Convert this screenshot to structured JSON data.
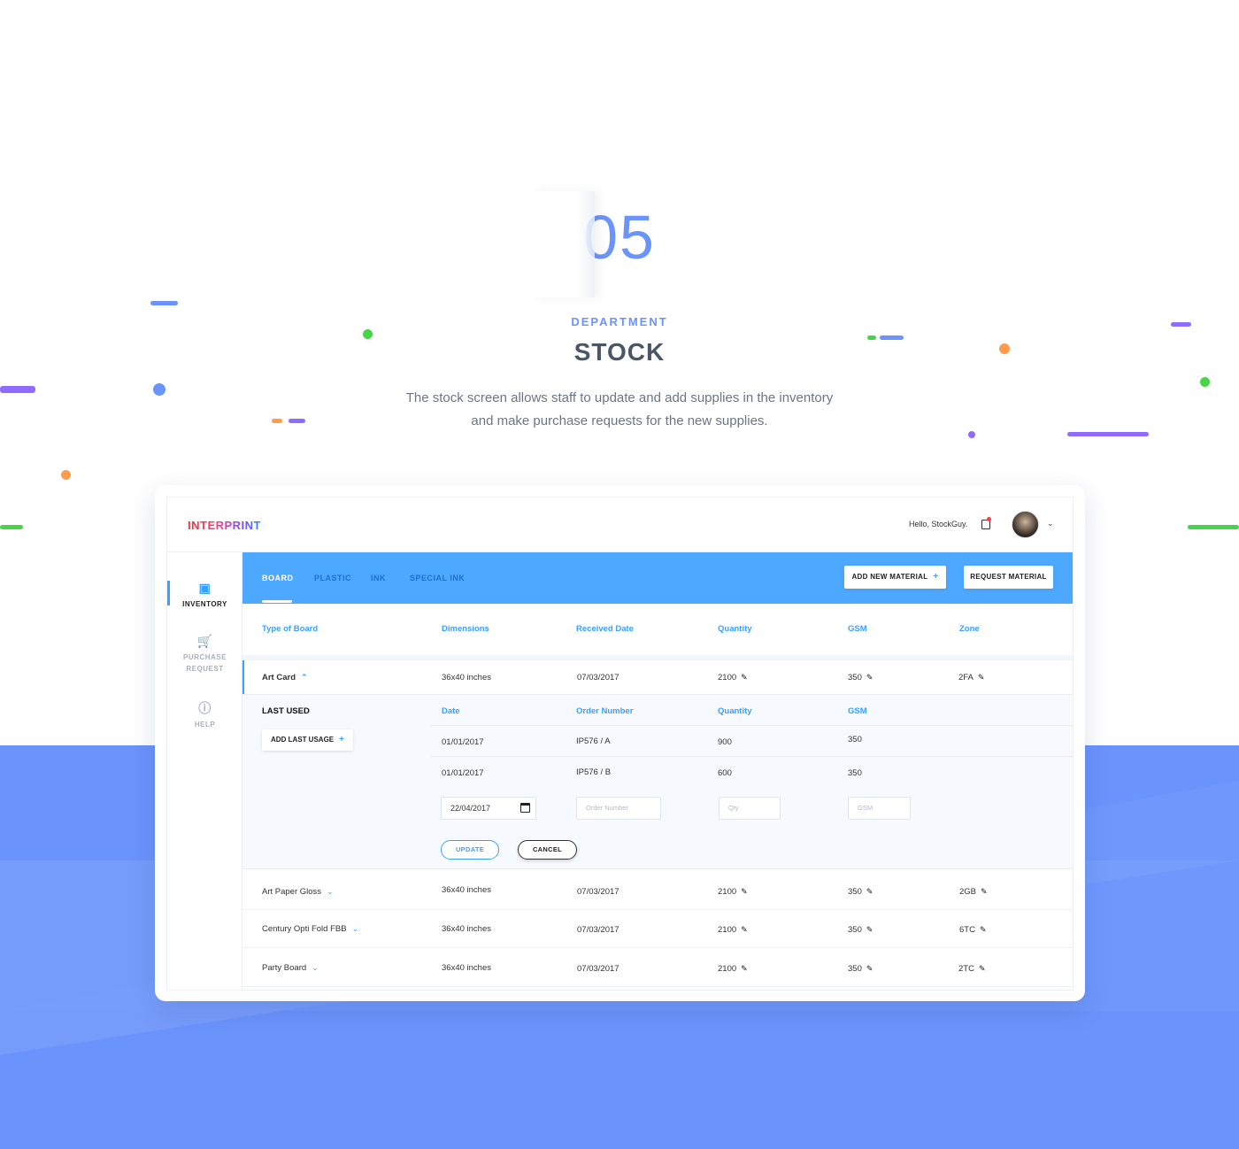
{
  "hero": {
    "number": "05",
    "eyebrow": "DEPARTMENT",
    "title": "STOCK",
    "description_line1": "The stock screen allows staff to update and add supplies in the inventory",
    "description_line2": "and make purchase requests for the new supplies."
  },
  "app": {
    "logo": "INTERPRINT",
    "greeting": "Hello, StockGuy.",
    "icons": {
      "notification": "notification-icon",
      "avatar": "user-avatar",
      "caret": "chevron-down-icon"
    }
  },
  "sidebar": {
    "items": [
      {
        "label": "INVENTORY",
        "icon": "forklift-icon",
        "active": true
      },
      {
        "label_line1": "PURCHASE",
        "label_line2": "REQUEST",
        "icon": "cart-icon",
        "active": false
      },
      {
        "label": "HELP",
        "icon": "help-icon",
        "active": false
      }
    ]
  },
  "tabs": [
    "BOARD",
    "PLASTIC",
    "INK",
    "SPECIAL INK"
  ],
  "actions": {
    "add_new_material": "ADD NEW MATERIAL",
    "request_material": "REQUEST MATERIAL",
    "plus": "+"
  },
  "table": {
    "headers": [
      "Type of Board",
      "Dimensions",
      "Received Date",
      "Quantity",
      "GSM",
      "Zone"
    ],
    "rows": [
      {
        "type": "Art Card",
        "dimensions": "36x40 inches",
        "received": "07/03/2017",
        "quantity": "2100",
        "gsm": "350",
        "zone": "2FA"
      },
      {
        "type": "Art Paper Gloss",
        "dimensions": "36x40 inches",
        "received": "07/03/2017",
        "quantity": "2100",
        "gsm": "350",
        "zone": "2GB"
      },
      {
        "type": "Century Opti Fold FBB",
        "dimensions": "36x40 inches",
        "received": "07/03/2017",
        "quantity": "2100",
        "gsm": "350",
        "zone": "6TC"
      },
      {
        "type": "Party Board",
        "dimensions": "36x40 inches",
        "received": "07/03/2017",
        "quantity": "2100",
        "gsm": "350",
        "zone": "2TC"
      }
    ]
  },
  "last_used": {
    "title": "LAST USED",
    "add_button": "ADD LAST USAGE",
    "headers": [
      "Date",
      "Order Number",
      "Quantity",
      "GSM"
    ],
    "rows": [
      {
        "date": "01/01/2017",
        "order": "IP576 / A",
        "quantity": "900",
        "gsm": "350"
      },
      {
        "date": "01/01/2017",
        "order": "IP576 / B",
        "quantity": "600",
        "gsm": "350"
      }
    ],
    "form": {
      "date_value": "22/04/2017",
      "order_placeholder": "Order Number",
      "qty_placeholder": "Qty",
      "gsm_placeholder": "GSM",
      "update": "UPDATE",
      "cancel": "CANCEL"
    }
  },
  "colors": {
    "accent": "#3aa0ff",
    "tabbar": "#4da8ff",
    "background_blue": "#6a93fb"
  }
}
